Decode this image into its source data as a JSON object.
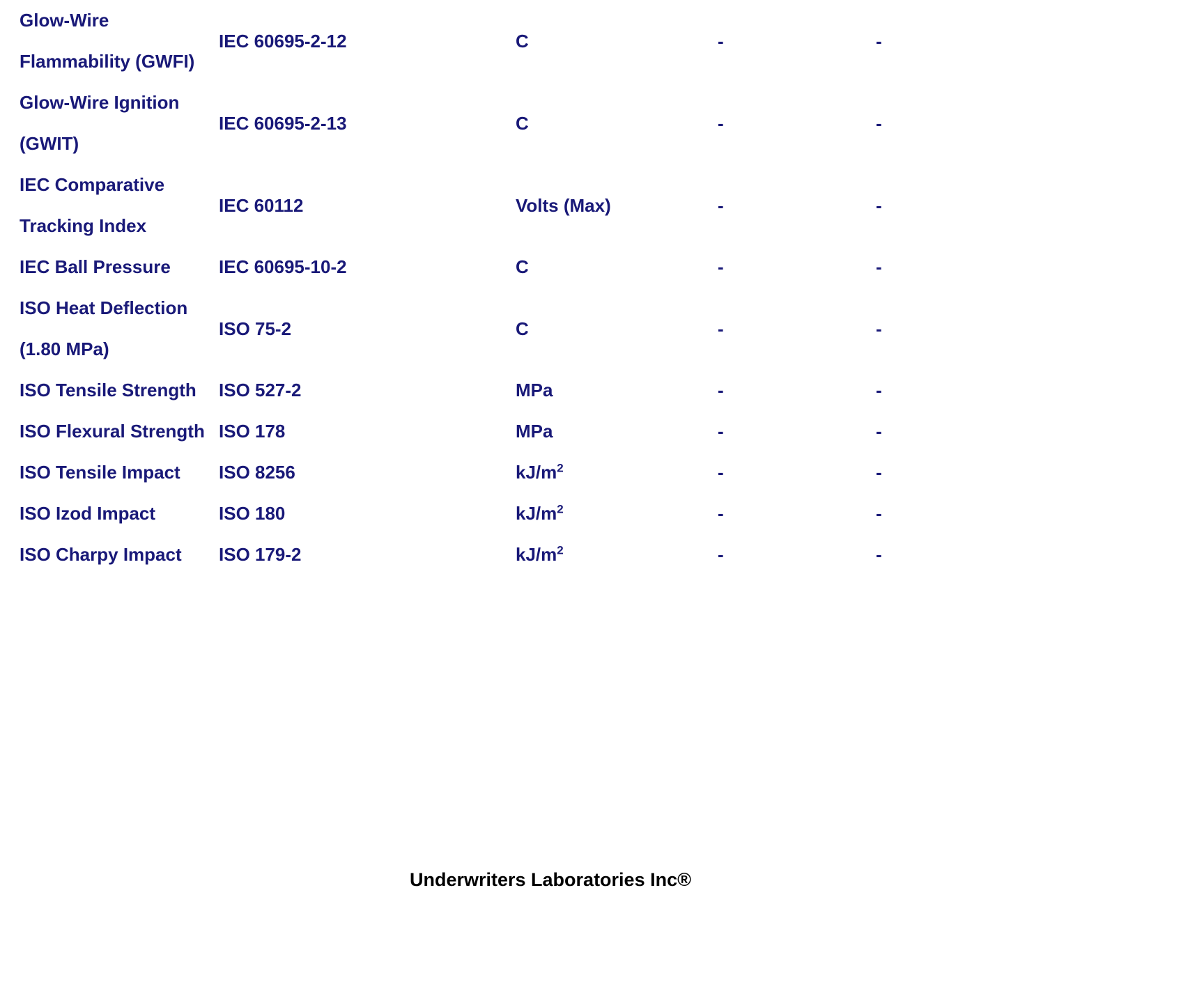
{
  "document": {
    "text_color": "#191978",
    "footer_color": "#000000",
    "background": "#ffffff"
  },
  "table": {
    "columns": [
      "property",
      "standard",
      "unit",
      "value_1",
      "value_2"
    ],
    "rows": [
      {
        "property": "Glow-Wire Flammability (GWFI)",
        "standard": "IEC 60695-2-12",
        "unit": "C",
        "unit_sup": "",
        "value_1": "-",
        "value_2": "-"
      },
      {
        "property": "Glow-Wire Ignition (GWIT)",
        "standard": "IEC 60695-2-13",
        "unit": "C",
        "unit_sup": "",
        "value_1": "-",
        "value_2": "-"
      },
      {
        "property": "IEC Comparative Tracking Index",
        "standard": "IEC 60112",
        "unit": "Volts (Max)",
        "unit_sup": "",
        "value_1": "-",
        "value_2": "-"
      },
      {
        "property": "IEC Ball Pressure",
        "standard": "IEC 60695-10-2",
        "unit": "C",
        "unit_sup": "",
        "value_1": "-",
        "value_2": "-"
      },
      {
        "property": "ISO Heat Deflection (1.80 MPa)",
        "standard": "ISO 75-2",
        "unit": "C",
        "unit_sup": "",
        "value_1": "-",
        "value_2": "-"
      },
      {
        "property": "ISO Tensile Strength",
        "standard": "ISO 527-2",
        "unit": "MPa",
        "unit_sup": "",
        "value_1": "-",
        "value_2": "-"
      },
      {
        "property": "ISO Flexural Strength",
        "standard": "ISO 178",
        "unit": "MPa",
        "unit_sup": "",
        "value_1": "-",
        "value_2": "-"
      },
      {
        "property": "ISO Tensile Impact",
        "standard": "ISO 8256",
        "unit": "kJ/m",
        "unit_sup": "2",
        "value_1": "-",
        "value_2": "-"
      },
      {
        "property": "ISO Izod Impact",
        "standard": "ISO 180",
        "unit": "kJ/m",
        "unit_sup": "2",
        "value_1": "-",
        "value_2": "-"
      },
      {
        "property": "ISO Charpy Impact",
        "standard": "ISO 179-2",
        "unit": "kJ/m",
        "unit_sup": "2",
        "value_1": "-",
        "value_2": "-"
      }
    ]
  },
  "footer": {
    "text": "Underwriters Laboratories Inc®"
  }
}
